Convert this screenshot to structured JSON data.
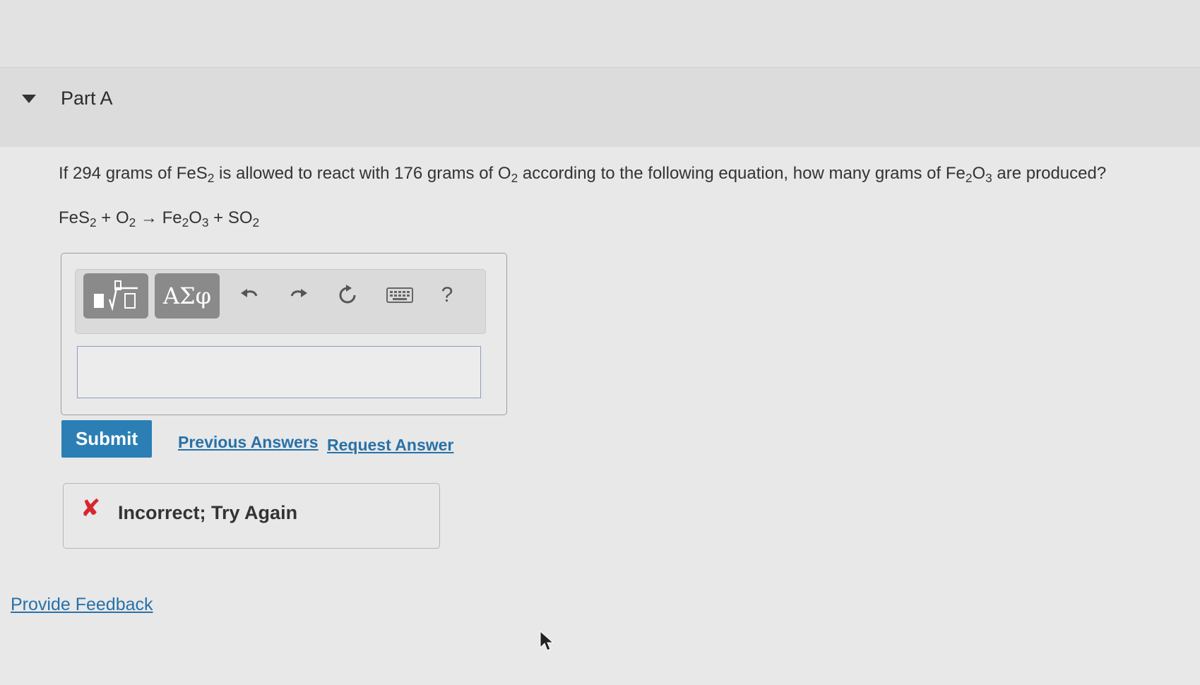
{
  "part": {
    "title": "Part A"
  },
  "question": {
    "text_1": "If 294 grams of FeS",
    "sub_1": "2",
    "text_2": " is allowed to react with 176 grams of O",
    "sub_2": "2",
    "text_3": " according to the following equation, how many grams of Fe",
    "sub_3": "2",
    "text_4": "O",
    "sub_4": "3",
    "text_5": " are produced?"
  },
  "equation": {
    "t1": "FeS",
    "s1": "2",
    "t2": " + O",
    "s2": "2",
    "t3": " → Fe",
    "s3": "2",
    "t4": "O",
    "s4": "3",
    "t5": " + SO",
    "s5": "2"
  },
  "toolbar": {
    "greek_label": "ΑΣφ",
    "help_label": "?",
    "icons": [
      "templates-icon",
      "undo-icon",
      "redo-icon",
      "reset-icon",
      "keyboard-icon",
      "help-icon"
    ]
  },
  "answer": {
    "value": "",
    "placeholder": ""
  },
  "actions": {
    "submit_label": "Submit",
    "previous_answers_label": "Previous Answers",
    "request_answer_label": "Request Answer"
  },
  "feedback": {
    "icon": "✘",
    "text": "Incorrect; Try Again",
    "icon_color": "#d8252f"
  },
  "footer": {
    "provide_feedback_label": "Provide Feedback"
  },
  "colors": {
    "accent": "#2b7fb4",
    "link": "#2871a8",
    "error": "#d8252f"
  }
}
